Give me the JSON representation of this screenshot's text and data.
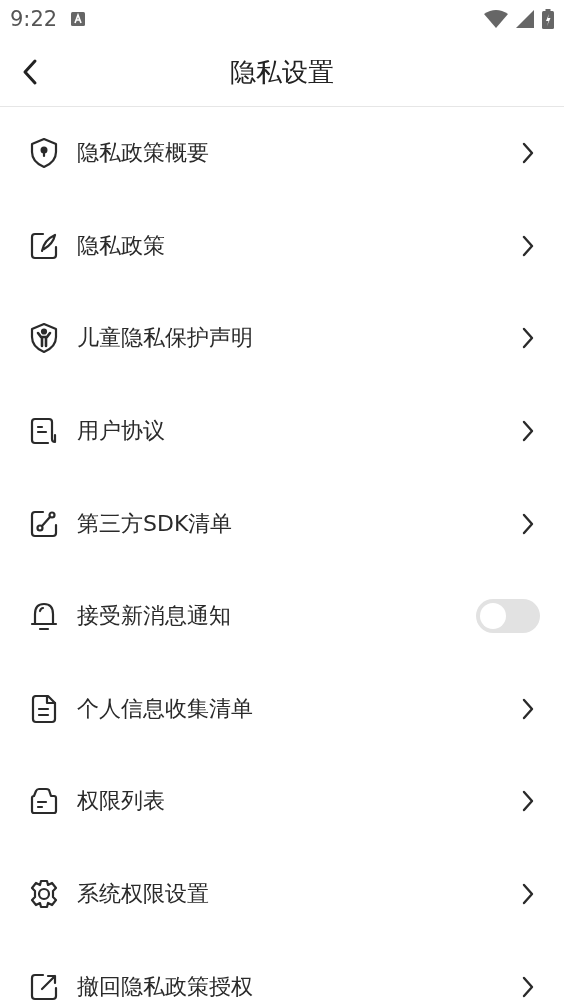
{
  "status_bar": {
    "time": "9:22"
  },
  "header": {
    "title": "隐私设置"
  },
  "items": [
    {
      "kind": "link",
      "label": "隐私政策概要"
    },
    {
      "kind": "link",
      "label": "隐私政策"
    },
    {
      "kind": "link",
      "label": "儿童隐私保护声明"
    },
    {
      "kind": "link",
      "label": "用户协议"
    },
    {
      "kind": "link",
      "label": "第三方SDK清单"
    },
    {
      "kind": "toggle",
      "label": "接受新消息通知",
      "on": false
    },
    {
      "kind": "link",
      "label": "个人信息收集清单"
    },
    {
      "kind": "link",
      "label": "权限列表"
    },
    {
      "kind": "link",
      "label": "系统权限设置"
    },
    {
      "kind": "link",
      "label": "撤回隐私政策授权"
    }
  ]
}
